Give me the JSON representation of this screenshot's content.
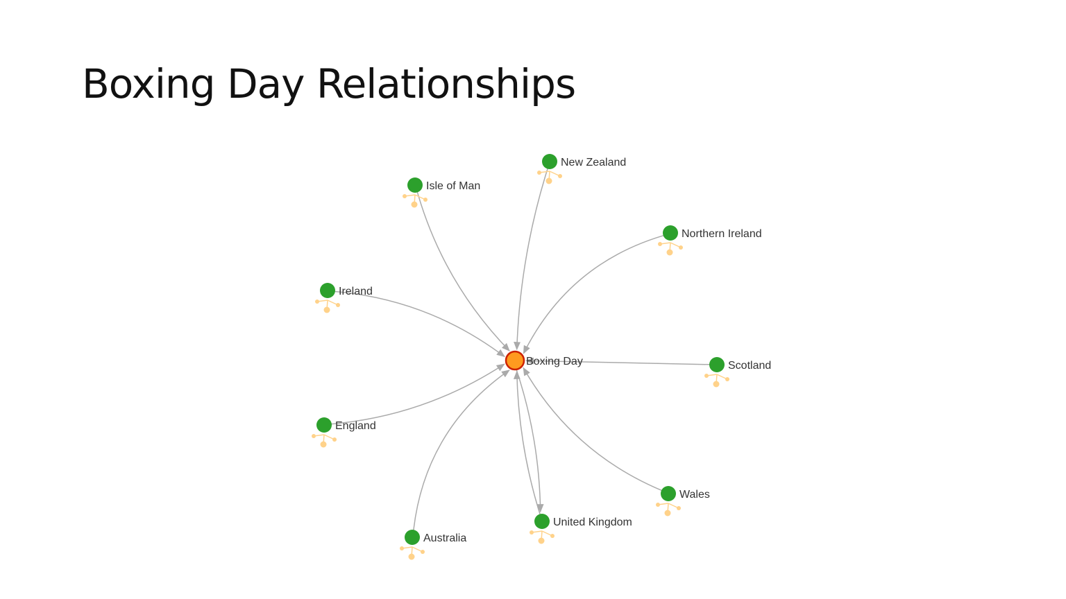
{
  "title": "Boxing Day Relationships",
  "colors": {
    "central_fill": "#ff9a1f",
    "central_stroke": "#cc2200",
    "node_fill": "#2ca02c",
    "edge": "#aaaaaa",
    "label": "#333333",
    "handle": "#ffd28a"
  },
  "graph": {
    "central": {
      "id": "boxing-day",
      "label": "Boxing Day"
    },
    "nodes": [
      {
        "id": "new-zealand",
        "label": "New Zealand"
      },
      {
        "id": "isle-of-man",
        "label": "Isle of Man"
      },
      {
        "id": "northern-ireland",
        "label": "Northern Ireland"
      },
      {
        "id": "ireland",
        "label": "Ireland"
      },
      {
        "id": "scotland",
        "label": "Scotland"
      },
      {
        "id": "england",
        "label": "England"
      },
      {
        "id": "wales",
        "label": "Wales"
      },
      {
        "id": "united-kingdom",
        "label": "United Kingdom"
      },
      {
        "id": "australia",
        "label": "Australia"
      }
    ],
    "edges": [
      {
        "from": "new-zealand",
        "to": "boxing-day"
      },
      {
        "from": "isle-of-man",
        "to": "boxing-day"
      },
      {
        "from": "northern-ireland",
        "to": "boxing-day"
      },
      {
        "from": "ireland",
        "to": "boxing-day"
      },
      {
        "from": "scotland",
        "to": "boxing-day"
      },
      {
        "from": "england",
        "to": "boxing-day"
      },
      {
        "from": "wales",
        "to": "boxing-day"
      },
      {
        "from": "united-kingdom",
        "to": "boxing-day"
      },
      {
        "from": "australia",
        "to": "boxing-day"
      },
      {
        "from": "boxing-day",
        "to": "united-kingdom"
      }
    ]
  }
}
